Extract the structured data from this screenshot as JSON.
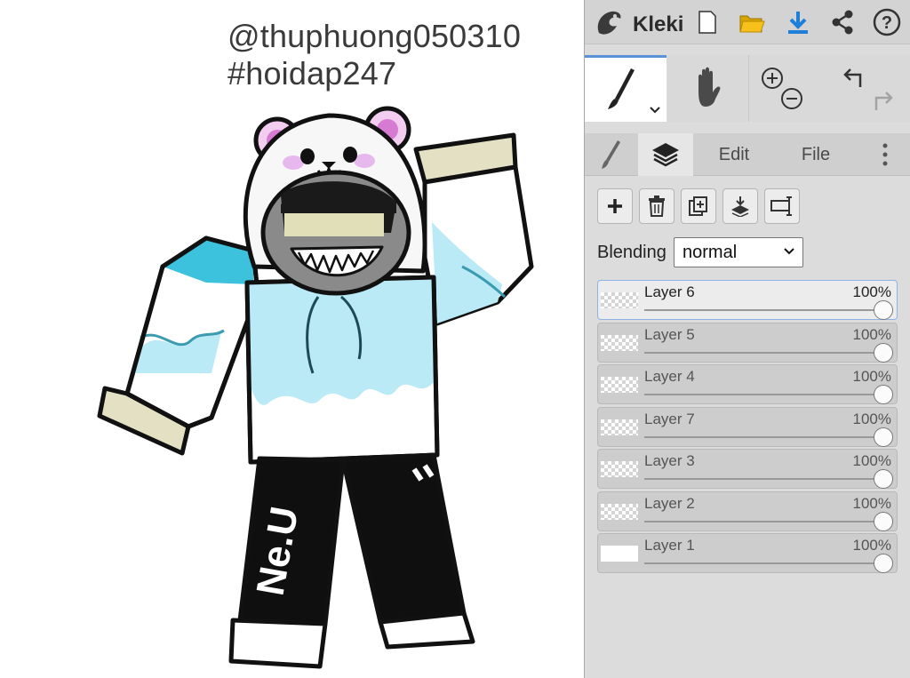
{
  "canvas": {
    "watermark_line1": "@thuphuong050310",
    "watermark_line2": "#hoidap247",
    "pants_text": "Ne.U"
  },
  "app": {
    "name": "Kleki",
    "toolbar_icons": [
      "new-document-icon",
      "open-folder-icon",
      "download-icon",
      "share-icon",
      "help-icon"
    ],
    "accent_color": "#1e7fd8",
    "folder_color": "#f5c11a"
  },
  "tools": {
    "active": "brush",
    "items": [
      "brush-icon",
      "hand-icon",
      "zoom-in-icon",
      "zoom-out-icon",
      "undo-icon",
      "redo-icon"
    ]
  },
  "tabs": {
    "brush_icon": "brush-icon",
    "layers_icon": "layers-icon",
    "edit": "Edit",
    "file": "File",
    "more_icon": "more-vertical-icon",
    "active": "layers"
  },
  "layers_panel": {
    "buttons": [
      "add-layer-icon",
      "delete-layer-icon",
      "duplicate-layer-icon",
      "merge-down-icon",
      "rename-layer-icon"
    ],
    "blending_label": "Blending",
    "blending_value": "normal",
    "layers": [
      {
        "name": "Layer 6",
        "opacity": "100%",
        "selected": true
      },
      {
        "name": "Layer 5",
        "opacity": "100%",
        "selected": false
      },
      {
        "name": "Layer 4",
        "opacity": "100%",
        "selected": false
      },
      {
        "name": "Layer 7",
        "opacity": "100%",
        "selected": false
      },
      {
        "name": "Layer 3",
        "opacity": "100%",
        "selected": false
      },
      {
        "name": "Layer 2",
        "opacity": "100%",
        "selected": false
      },
      {
        "name": "Layer 1",
        "opacity": "100%",
        "selected": false
      }
    ]
  }
}
